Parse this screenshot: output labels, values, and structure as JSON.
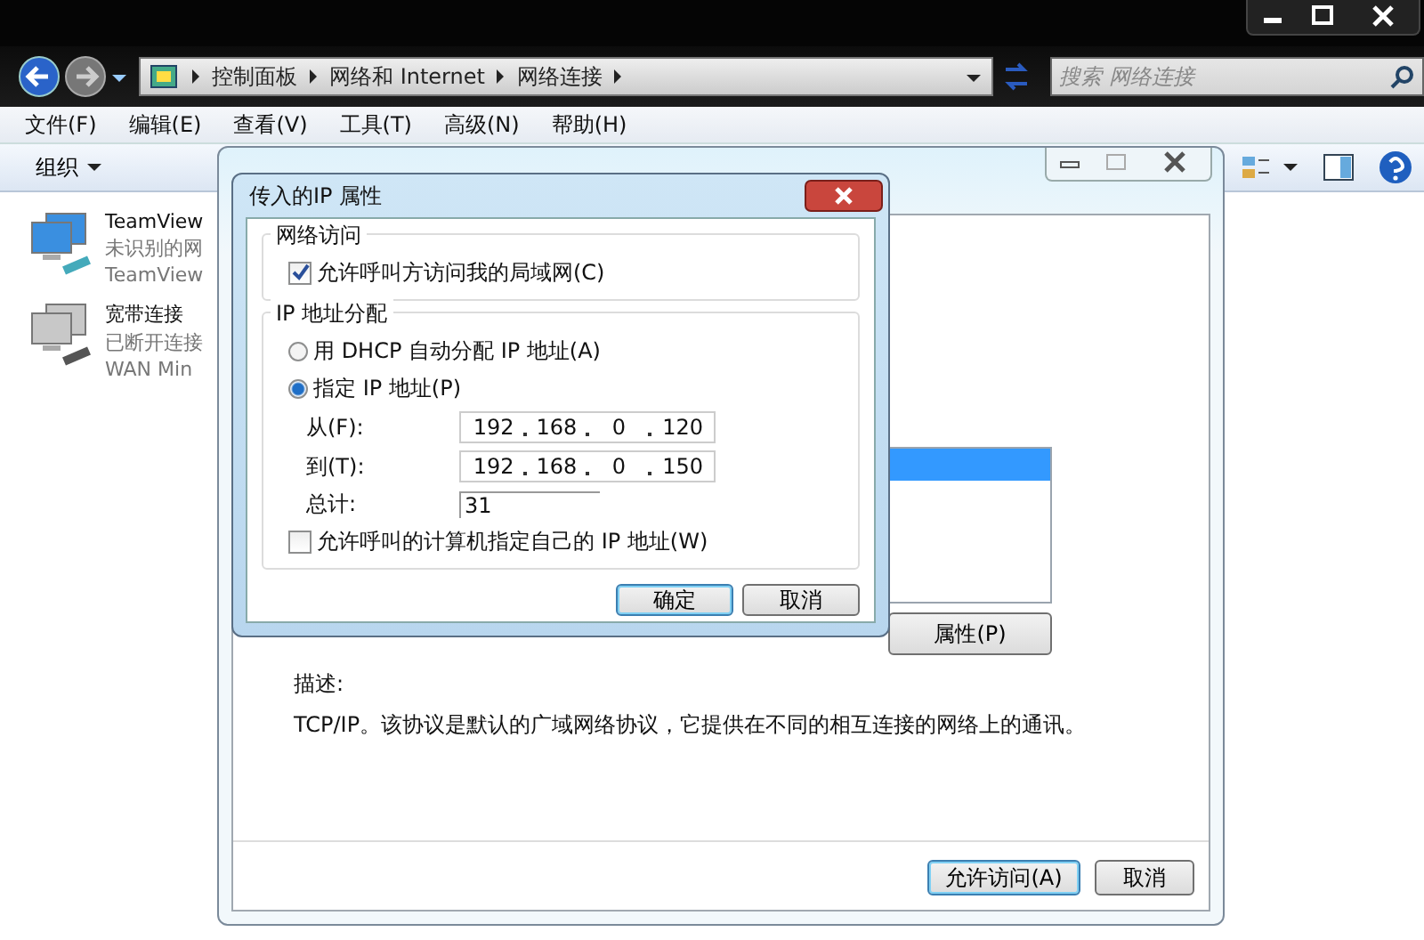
{
  "address_bar": {
    "breadcrumbs": [
      "控制面板",
      "网络和 Internet",
      "网络连接"
    ]
  },
  "search": {
    "placeholder": "搜索 网络连接"
  },
  "menu": [
    "文件(F)",
    "编辑(E)",
    "查看(V)",
    "工具(T)",
    "高级(N)",
    "帮助(H)"
  ],
  "toolbar": {
    "organize": "组织"
  },
  "connections": [
    {
      "name": "TeamView",
      "status": "未识别的网",
      "device": "TeamView",
      "connected": true
    },
    {
      "name": "宽带连接",
      "status": "已断开连接",
      "device": "WAN Min",
      "connected": false
    }
  ],
  "properties_window": {
    "protocol_rows": [
      {
        "selected": true
      },
      {
        "selected": false
      }
    ],
    "properties_button": "属性(P)",
    "description_label": "描述:",
    "description": "TCP/IP。该协议是默认的广域网络协议，它提供在不同的相互连接的网络上的通讯。",
    "buttons": [
      "允许访问(A)",
      "取消"
    ]
  },
  "dialog": {
    "title": "传入的IP 属性",
    "network_access": {
      "title": "网络访问",
      "option": {
        "label": "允许呼叫方访问我的局域网(C)",
        "checked": true
      }
    },
    "ip_assignment": {
      "title": "IP 地址分配",
      "options": [
        {
          "label": "用 DHCP 自动分配 IP 地址(A)",
          "selected": false
        },
        {
          "label": "指定 IP 地址(P)",
          "selected": true
        }
      ],
      "from": {
        "label": "从(F):",
        "octets": [
          "192",
          "168",
          "0",
          "120"
        ]
      },
      "to": {
        "label": "到(T):",
        "octets": [
          "192",
          "168",
          "0",
          "150"
        ]
      },
      "total": {
        "label": "总计:",
        "value": "31"
      },
      "allow_own": {
        "label": "允许呼叫的计算机指定自己的 IP 地址(W)",
        "checked": false
      }
    },
    "buttons": [
      "确定",
      "取消"
    ]
  }
}
